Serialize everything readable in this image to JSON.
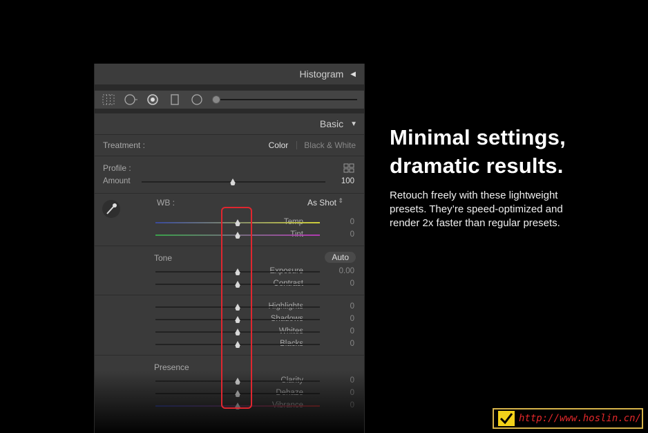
{
  "panel": {
    "histogram_title": "Histogram",
    "basic_title": "Basic",
    "treatment": {
      "label": "Treatment :",
      "option_color": "Color",
      "option_bw": "Black & White"
    },
    "profile": {
      "label": "Profile :",
      "amount_label": "Amount",
      "amount_value": "100"
    },
    "wb": {
      "label": "WB :",
      "value": "As Shot"
    },
    "sliders_wb": [
      {
        "label": "Temp",
        "value": "0"
      },
      {
        "label": "Tint",
        "value": "0"
      }
    ],
    "tone": {
      "title": "Tone",
      "auto_label": "Auto"
    },
    "sliders_tone": [
      {
        "label": "Exposure",
        "value": "0.00"
      },
      {
        "label": "Contrast",
        "value": "0"
      }
    ],
    "sliders_light": [
      {
        "label": "Highlights",
        "value": "0"
      },
      {
        "label": "Shadows",
        "value": "0"
      },
      {
        "label": "Whites",
        "value": "0"
      },
      {
        "label": "Blacks",
        "value": "0"
      }
    ],
    "presence": {
      "title": "Presence"
    },
    "sliders_presence": [
      {
        "label": "Clarity",
        "value": "0"
      },
      {
        "label": "Dehaze",
        "value": "0"
      },
      {
        "label": "Vibrance",
        "value": "0"
      }
    ]
  },
  "headline": {
    "line1": "Minimal settings,",
    "line2": "dramatic results."
  },
  "body_copy": "Retouch freely with these lightweight presets. They’re speed-optimized and render 2x faster than regular presets.",
  "watermark": {
    "url": "http://www.hoslin.cn/"
  },
  "colors": {
    "highlight": "#e0262f",
    "watermark_border": "#d6b34a",
    "watermark_text": "#e2282a",
    "check_bg": "#f2d21a"
  }
}
